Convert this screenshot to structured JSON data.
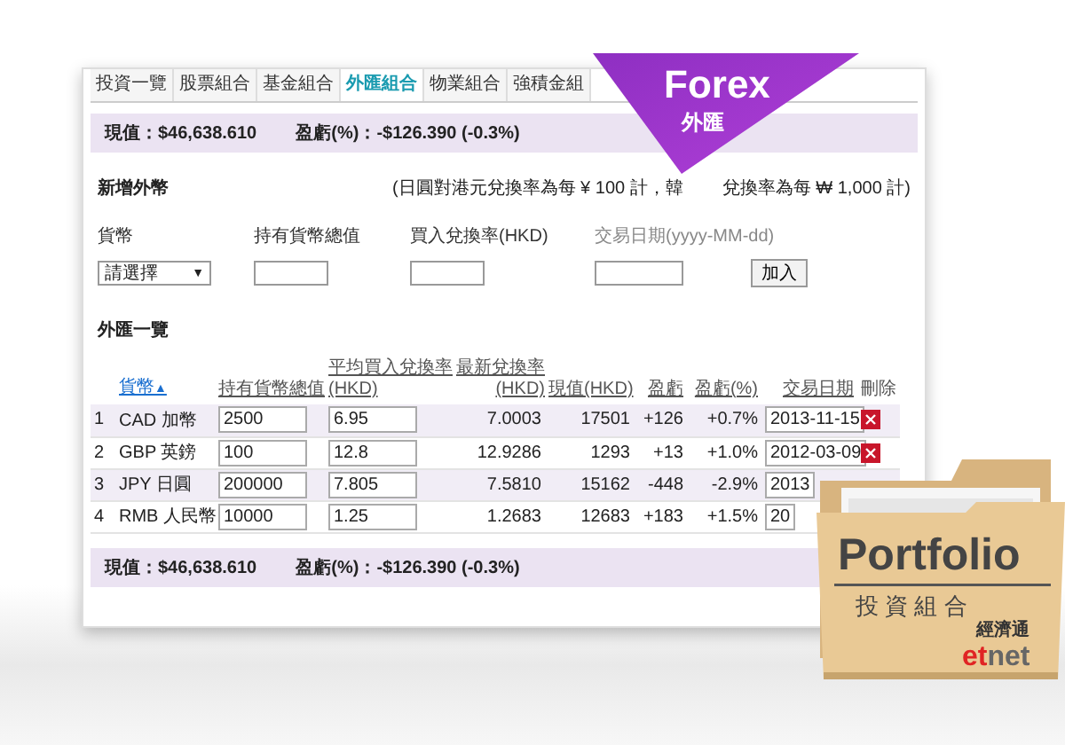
{
  "tabs": [
    {
      "label": "投資一覽",
      "selected": false
    },
    {
      "label": "股票組合",
      "selected": false
    },
    {
      "label": "基金組合",
      "selected": false
    },
    {
      "label": "外匯組合",
      "selected": true
    },
    {
      "label": "物業組合",
      "selected": false
    },
    {
      "label": "強積金組",
      "selected": false
    }
  ],
  "summary_top": {
    "value_label": "現值",
    "value": "：$46,638.610",
    "pl_label": "盈虧(%)",
    "pl": "：-$126.390 (-0.3%)"
  },
  "add_section": {
    "title": "新增外幣",
    "note_start": "(日圓對港元兌換率為每 ¥ 100 計，韓",
    "note_end": "兌換率為每 ₩ 1,000 計)",
    "currency_label": "貨幣",
    "currency_select": "請選擇",
    "currency_caret": "▼",
    "holding_label": "持有貨幣總值",
    "rate_label": "買入兌換率(HKD)",
    "date_label": "交易日期(yyyy-MM-dd)",
    "add_button": "加入"
  },
  "list_title": "外匯一覽",
  "table": {
    "columns": [
      {
        "lines": [
          "貨幣"
        ],
        "sorted": true,
        "arrow": "▲"
      },
      {
        "lines": [
          "持有貨幣總值"
        ],
        "sorted": false
      },
      {
        "lines": [
          "平均買入兌換率",
          "(HKD)"
        ],
        "sorted": false
      },
      {
        "lines": [
          "最新兌換率",
          "(HKD)"
        ],
        "sorted": false
      },
      {
        "lines": [
          "現值(HKD)"
        ],
        "sorted": false
      },
      {
        "lines": [
          "盈虧"
        ],
        "sorted": false
      },
      {
        "lines": [
          "盈虧(%)"
        ],
        "sorted": false
      },
      {
        "lines": [
          "交易日期"
        ],
        "sorted": false
      },
      {
        "lines": [
          "刪除"
        ],
        "sorted": false
      }
    ],
    "rows": [
      {
        "index": "1",
        "currency": "CAD 加幣",
        "holding": "2500",
        "avg_rate": "6.95",
        "latest_rate": "7.0003",
        "value": "17501",
        "pl": "+126",
        "pl_pct": "+0.7%",
        "date": "2013-11-15",
        "delete_shown": true
      },
      {
        "index": "2",
        "currency": "GBP 英鎊",
        "holding": "100",
        "avg_rate": "12.8",
        "latest_rate": "12.9286",
        "value": "1293",
        "pl": "+13",
        "pl_pct": "+1.0%",
        "date": "2012-03-09",
        "delete_shown": true
      },
      {
        "index": "3",
        "currency": "JPY 日圓",
        "holding": "200000",
        "avg_rate": "7.805",
        "latest_rate": "7.5810",
        "value": "15162",
        "pl": "-448",
        "pl_pct": "-2.9%",
        "date": "2013",
        "delete_shown": false
      },
      {
        "index": "4",
        "currency": "RMB 人民幣",
        "holding": "10000",
        "avg_rate": "1.25",
        "latest_rate": "1.2683",
        "value": "12683",
        "pl": "+183",
        "pl_pct": "+1.5%",
        "date": "20",
        "delete_shown": false
      }
    ]
  },
  "summary_bottom": {
    "value_label": "現值",
    "value": "：$46,638.610",
    "pl_label": "盈虧(%)",
    "pl": "：-$126.390 (-0.3%)"
  },
  "ribbon": {
    "title": "Forex",
    "subtitle": "外匯"
  },
  "folder": {
    "title": "Portfolio",
    "subtitle": "投 資 組 合",
    "brand_chinese": "經濟通",
    "logo_part_1": "et",
    "logo_part_2": "net"
  }
}
